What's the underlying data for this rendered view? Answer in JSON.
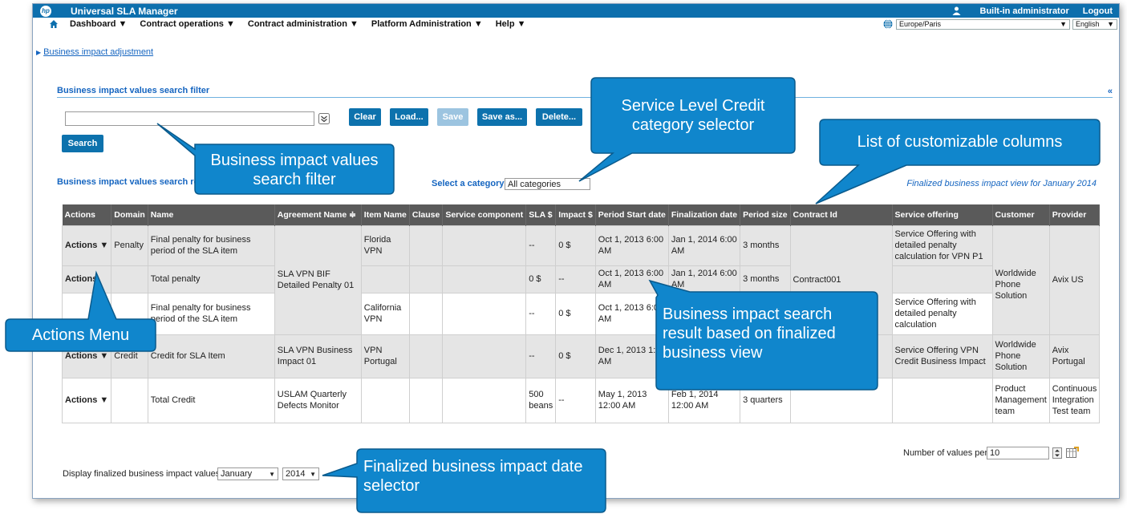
{
  "app": {
    "logo": "hp",
    "title": "Universal SLA Manager",
    "user": "Built-in administrator",
    "logout": "Logout"
  },
  "menu": {
    "items": [
      "Dashboard ▼",
      "Contract operations ▼",
      "Contract administration ▼",
      "Platform Administration ▼",
      "Help ▼"
    ],
    "timezone": "Europe/Paris",
    "language": "English"
  },
  "breadcrumb": "Business impact adjustment",
  "filter": {
    "title": "Business impact values search filter",
    "query_value": "",
    "buttons": {
      "clear": "Clear",
      "load": "Load...",
      "save": "Save",
      "save_as": "Save as...",
      "delete": "Delete...",
      "search": "Search"
    },
    "collapse": "«"
  },
  "results": {
    "title": "Business impact values search results",
    "category_label": "Select a category",
    "category_value": "All categories",
    "view_label": "Finalized business impact view for January 2014"
  },
  "table": {
    "headers": [
      "Actions",
      "Domain",
      "Name",
      "Agreement Name ≑",
      "Item Name",
      "Clause",
      "Service component",
      "SLA $",
      "Impact $",
      "Period Start date",
      "Finalization date",
      "Period size",
      "Contract Id",
      "Service offering",
      "Customer",
      "Provider"
    ],
    "rows": [
      {
        "actions": "Actions ▼",
        "domain": "Penalty",
        "name": "Final penalty for business period of the SLA item",
        "agreement": "SLA VPN BIF Detailed Penalty 01",
        "item": "Florida VPN",
        "clause": "",
        "component": "",
        "sla": "--",
        "impact": "0 $",
        "start": "Oct 1, 2013 6:00 AM",
        "final": "Jan 1, 2014 6:00 AM",
        "size": "3 months",
        "contract": "Contract001",
        "offering": "Service Offering with detailed penalty calculation for VPN P1",
        "customer": "Worldwide Phone Solution",
        "provider": "Avix US"
      },
      {
        "actions": "Actions",
        "domain": "",
        "name": "Total penalty",
        "item": "",
        "clause": "",
        "component": "",
        "sla": "0 $",
        "impact": "--",
        "start": "Oct 1, 2013 6:00 AM",
        "final": "Jan 1, 2014 6:00 AM",
        "size": "3 months",
        "offering": ""
      },
      {
        "actions": "",
        "domain": "",
        "name": "Final penalty for business period of the SLA item",
        "item": "California VPN",
        "clause": "",
        "component": "",
        "sla": "--",
        "impact": "0 $",
        "start": "Oct 1, 2013 6:00 AM",
        "final": "",
        "size": "",
        "offering": "Service Offering with detailed penalty calculation"
      },
      {
        "actions": "Actions ▼",
        "domain": "Credit",
        "name": "Credit for SLA Item",
        "agreement": "SLA VPN Business Impact 01",
        "item": "VPN Portugal",
        "clause": "",
        "component": "",
        "sla": "--",
        "impact": "0 $",
        "start": "Dec 1, 2013 1:00 AM",
        "final": "Jan 1, 2014 1:00 AM",
        "size": "",
        "contract": "",
        "offering": "Service Offering VPN Credit Business Impact",
        "customer": "Worldwide Phone Solution",
        "provider": "Avix Portugal"
      },
      {
        "actions": "Actions ▼",
        "domain": "",
        "name": "Total Credit",
        "agreement": "USLAM Quarterly Defects Monitor",
        "item": "",
        "clause": "",
        "component": "",
        "sla": "500 beans",
        "impact": "--",
        "start": "May 1, 2013 12:00 AM",
        "final": "Feb 1, 2014 12:00 AM",
        "size": "3 quarters",
        "contract": "",
        "offering": "",
        "customer": "Product Management team",
        "provider": "Continuous Integration Test team"
      }
    ]
  },
  "paging": {
    "per_page_label": "Number of values per page:",
    "per_page_value": "10"
  },
  "display": {
    "label": "Display finalized business impact values",
    "month": "January",
    "year": "2014"
  },
  "callouts": {
    "filter": "Business impact values search filter",
    "category": "Service Level Credit category selector",
    "columns": "List of customizable columns",
    "actions": "Actions Menu",
    "result": "Business impact search result based on finalized business view",
    "date": "Finalized business impact date selector"
  },
  "colors": {
    "brand": "#0d6fad",
    "callout": "#1086cc",
    "header": "#5a5a5a",
    "link": "#1565c0"
  }
}
